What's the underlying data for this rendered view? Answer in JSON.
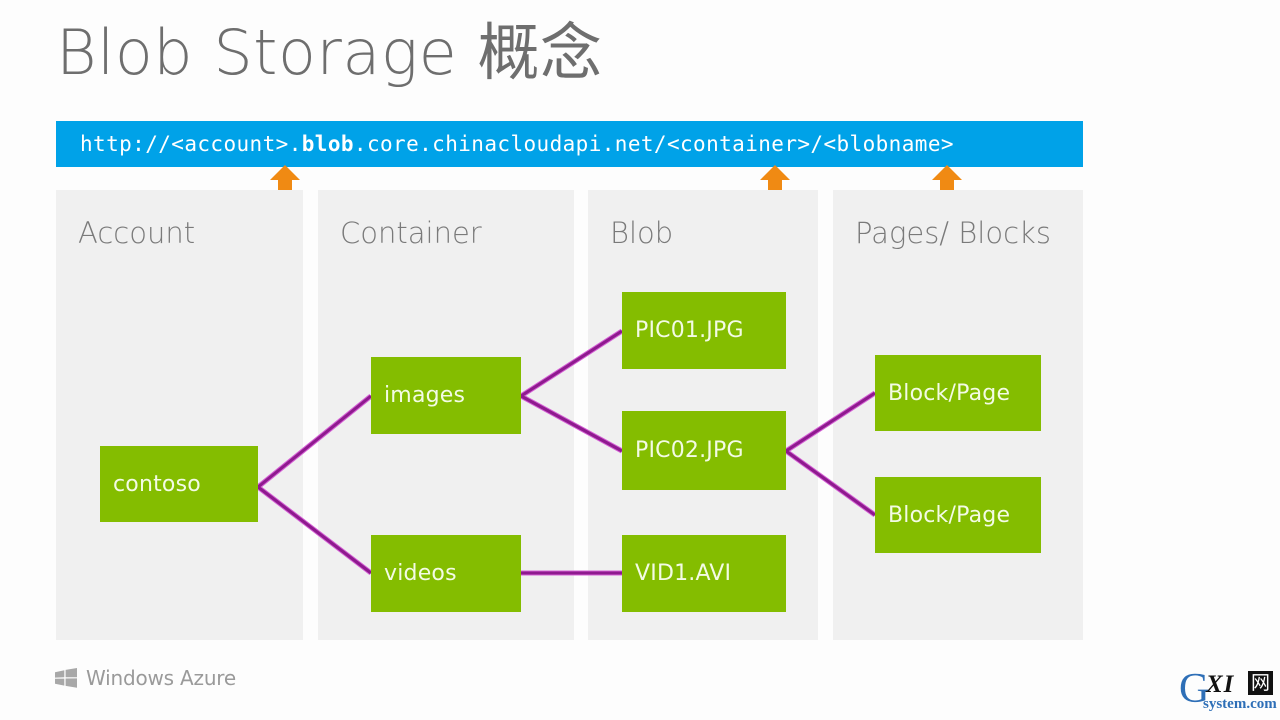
{
  "slide": {
    "title": "Blob Storage 概念"
  },
  "url_bar": {
    "prefix": "http://<account>.",
    "emphasis": "blob",
    "suffix": ".core.chinacloudapi.net/<container>/<blobname>",
    "full": "http://<account>.blob.core.chinacloudapi.net/<container>/<blobname>",
    "background_color": "#00a2e8",
    "text_color": "#ffffff"
  },
  "pointers": [
    {
      "name": "account-pointer",
      "target": "<account>",
      "color": "#f08a13"
    },
    {
      "name": "container-pointer",
      "target": "<container>",
      "color": "#f08a13"
    },
    {
      "name": "blobname-pointer",
      "target": "<blobname>",
      "color": "#f08a13"
    }
  ],
  "columns": [
    {
      "id": "account",
      "title": "Account"
    },
    {
      "id": "container",
      "title": "Container"
    },
    {
      "id": "blob",
      "title": "Blob"
    },
    {
      "id": "pages",
      "title": "Pages/ Blocks"
    }
  ],
  "nodes": {
    "contoso": "contoso",
    "images": "images",
    "videos": "videos",
    "pic01": "PIC01.JPG",
    "pic02": "PIC02.JPG",
    "vid1": "VID1.AVI",
    "blockpage_1": "Block/Page",
    "blockpage_2": "Block/Page"
  },
  "connections": [
    {
      "from": "contoso",
      "to": "images"
    },
    {
      "from": "contoso",
      "to": "videos"
    },
    {
      "from": "images",
      "to": "pic01"
    },
    {
      "from": "images",
      "to": "pic02"
    },
    {
      "from": "videos",
      "to": "vid1"
    },
    {
      "from": "pic02",
      "to": "blockpage_1"
    },
    {
      "from": "pic02",
      "to": "blockpage_2"
    }
  ],
  "footer": {
    "brand": "Windows Azure",
    "brand_icon": "windows-flag-icon"
  },
  "watermark": {
    "g": "G",
    "xi": "XI",
    "cjk": "网",
    "domain": "system.com"
  },
  "palette": {
    "node_fill": "#84bd00",
    "node_text": "#f3fbe4",
    "panel_fill": "#f0f0f0",
    "connector": "#8e1a8e",
    "connector_light": "#d45fd4",
    "accent_blue": "#00a2e8",
    "accent_orange": "#f08a13",
    "title_gray": "#6e6e6e"
  }
}
